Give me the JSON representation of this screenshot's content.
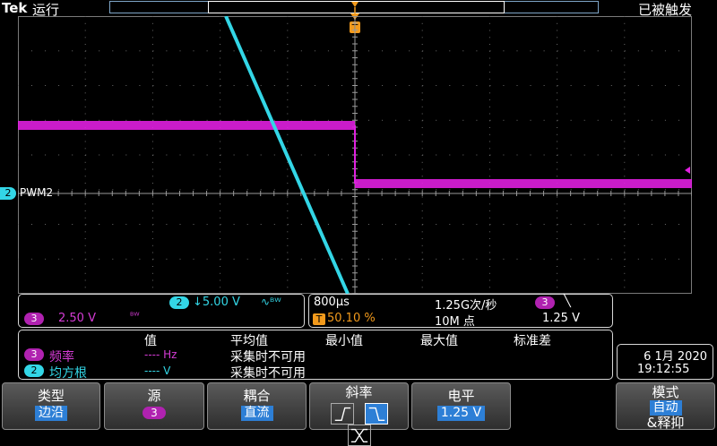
{
  "topbar": {
    "brand": "Tek",
    "run_state": "运行",
    "trigger_state": "已被触发",
    "trigger_marker": "T"
  },
  "channel2": {
    "marker": "2",
    "label": "PWM2"
  },
  "channel_panel": {
    "ch2_badge": "2",
    "ch2_scale": "↓5.00 V",
    "ch2_bw": "∿ᴮᵂ",
    "ch3_badge": "3",
    "ch3_scale": "2.50 V",
    "ch3_bw": "ᴮᵂ"
  },
  "timebase_panel": {
    "time_per_div": "800µs",
    "sample_rate": "1.25G次/秒",
    "trigger_badge": "3",
    "slope_symbol": "╲",
    "t_badge": "T",
    "trigger_position": "50.10 %",
    "record_length": "10M 点",
    "trigger_level": "1.25 V"
  },
  "measurements": {
    "headers": [
      "值",
      "平均值",
      "最小值",
      "最大值",
      "标准差"
    ],
    "rows": [
      {
        "badge": "3",
        "name": "频率",
        "value": "---- Hz",
        "status": "采集时不可用",
        "color": "magenta"
      },
      {
        "badge": "2",
        "name": "均方根",
        "value": "---- V",
        "status": "采集时不可用",
        "color": "cyan"
      }
    ]
  },
  "datetime": {
    "date": "6 1月 2020",
    "time": "19:12:55"
  },
  "softkeys": {
    "type_label": "类型",
    "type_value": "边沿",
    "source_label": "源",
    "source_value": "3",
    "coupling_label": "耦合",
    "coupling_value": "直流",
    "slope_label": "斜率",
    "level_label": "电平",
    "level_value": "1.25 V",
    "mode_label": "模式",
    "mode_value": "自动",
    "mode_extra": "&释抑"
  },
  "colors": {
    "ch2": "#33d6e6",
    "ch3": "#d63cd6",
    "trigger": "#f29a1c",
    "selected": "#2d7fd6"
  }
}
